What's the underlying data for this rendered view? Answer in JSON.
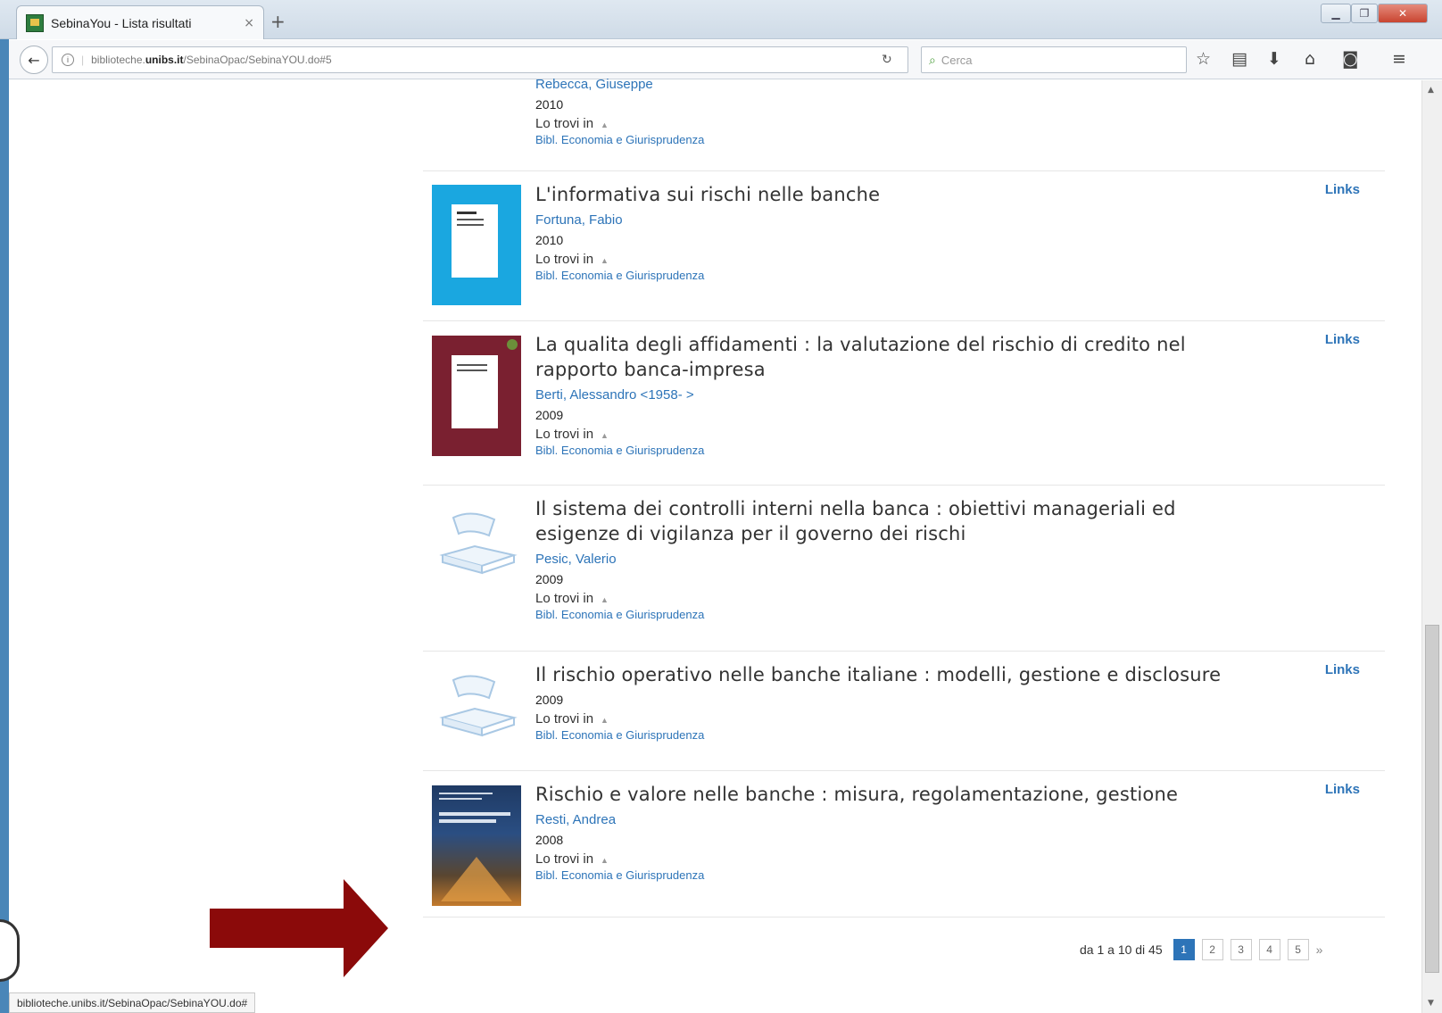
{
  "browser": {
    "tab_title": "SebinaYou - Lista risultati",
    "tab_close": "×",
    "new_tab": "+",
    "url_prefix": "biblioteche.",
    "url_domain": "unibs.it",
    "url_path": "/SebinaOpac/SebinaYOU.do#5",
    "search_placeholder": "Cerca",
    "status_url": "biblioteche.unibs.it/SebinaOpac/SebinaYOU.do#"
  },
  "labels": {
    "lo_trovi_in": "Lo trovi in",
    "links": "Links"
  },
  "results": [
    {
      "title": "",
      "author": "Rebecca, Giuseppe",
      "year": "2010",
      "library": "Bibl. Economia e Giurisprudenza",
      "has_links": false,
      "cover": "none"
    },
    {
      "title": "L'informativa sui rischi nelle banche",
      "author": "Fortuna, Fabio",
      "year": "2010",
      "library": "Bibl. Economia e Giurisprudenza",
      "has_links": true,
      "cover": "blue"
    },
    {
      "title_line1": "La qualita degli affidamenti : la valutazione del rischio di credito nel",
      "title_line2": "rapporto banca-impresa",
      "author": "Berti, Alessandro <1958- >",
      "year": "2009",
      "library": "Bibl. Economia e Giurisprudenza",
      "has_links": true,
      "cover": "maroon"
    },
    {
      "title_line1": "Il sistema dei controlli interni nella banca : obiettivi manageriali ed",
      "title_line2": "esigenze di vigilanza per il governo dei rischi",
      "author": "Pesic, Valerio",
      "year": "2009",
      "library": "Bibl. Economia e Giurisprudenza",
      "has_links": false,
      "cover": "placeholder-book"
    },
    {
      "title": "Il rischio operativo nelle banche italiane : modelli, gestione e disclosure",
      "author": "",
      "year": "2009",
      "library": "Bibl. Economia e Giurisprudenza",
      "has_links": true,
      "cover": "placeholder-book"
    },
    {
      "title": "Rischio e valore nelle banche : misura, regolamentazione, gestione",
      "author": "Resti, Andrea",
      "year": "2008",
      "library": "Bibl. Economia e Giurisprudenza",
      "has_links": true,
      "cover": "photo-dark-blue"
    }
  ],
  "pagination": {
    "summary": "da 1 a 10 di 45",
    "pages": [
      "1",
      "2",
      "3",
      "4",
      "5"
    ],
    "active_page": "1",
    "next": "»"
  },
  "colors": {
    "link_blue": "#2d74b8",
    "arrow_red": "#8b0a0a",
    "cover_blue": "#1aa7e0",
    "cover_maroon": "#7a2030"
  },
  "icons": [
    "back-arrow-icon",
    "info-icon",
    "reload-icon",
    "search-icon",
    "star-icon",
    "clipboard-icon",
    "download-icon",
    "home-icon",
    "pocket-icon",
    "menu-icon",
    "caret-up-icon",
    "book-placeholder-icon",
    "red-arrow-icon"
  ]
}
